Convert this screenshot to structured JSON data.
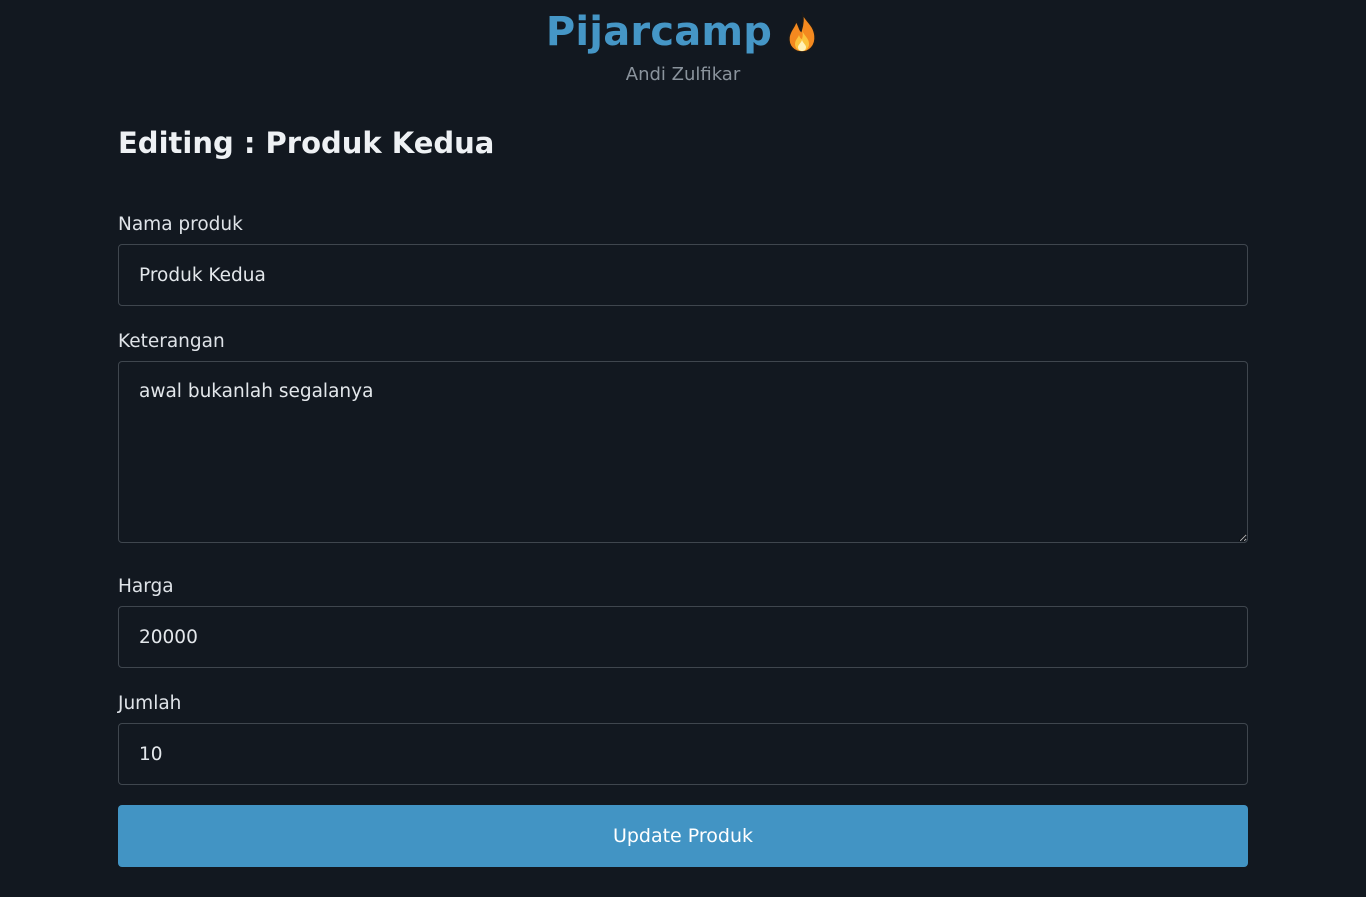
{
  "header": {
    "brand": "Pijarcamp",
    "brand_icon": "fire-icon",
    "subtitle": "Andi Zulfikar",
    "brand_color": "#4596c6"
  },
  "page": {
    "title": "Editing : Produk Kedua"
  },
  "form": {
    "name": {
      "label": "Nama produk",
      "value": "Produk Kedua"
    },
    "description": {
      "label": "Keterangan",
      "value": "awal bukanlah segalanya"
    },
    "price": {
      "label": "Harga",
      "value": "20000"
    },
    "quantity": {
      "label": "Jumlah",
      "value": "10"
    },
    "submit_label": "Update Produk",
    "submit_color": "#4294c4"
  }
}
